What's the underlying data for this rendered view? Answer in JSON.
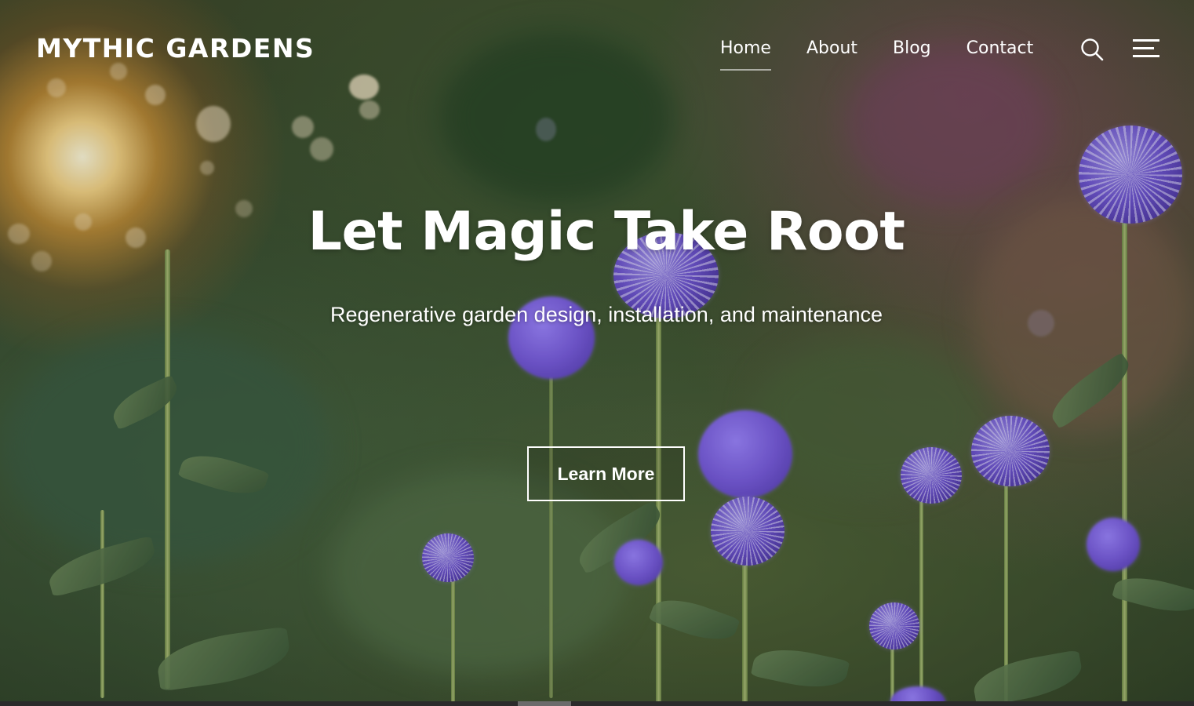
{
  "site": {
    "title": "MYTHIC GARDENS"
  },
  "nav": {
    "items": [
      {
        "label": "Home",
        "active": true
      },
      {
        "label": "About",
        "active": false
      },
      {
        "label": "Blog",
        "active": false
      },
      {
        "label": "Contact",
        "active": false
      }
    ],
    "search_icon": "search-icon",
    "menu_icon": "menu-icon"
  },
  "hero": {
    "heading": "Let Magic Take Root",
    "subheading": "Regenerative garden design, installation, and maintenance",
    "cta_label": "Learn More",
    "background": "garden-thistles-photo"
  },
  "colors": {
    "text": "#ffffff",
    "thistle": "#6f56d2"
  }
}
